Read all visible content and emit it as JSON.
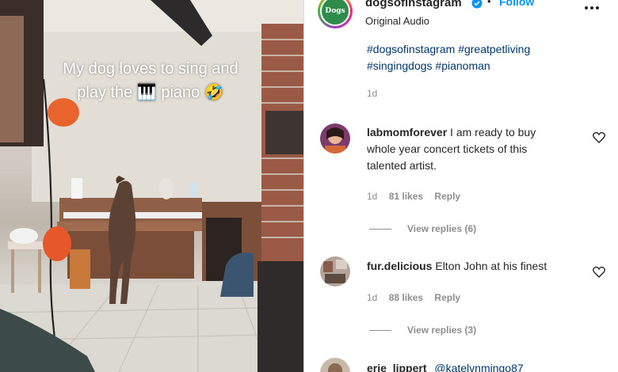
{
  "video": {
    "caption_line1": "My dog loves to sing and",
    "caption_line2_pre": "play the",
    "caption_line2_post": "piano",
    "piano_emoji": "🎹",
    "laugh_emoji": "🤣"
  },
  "post": {
    "username": "dogsofinstagram",
    "dot": "•",
    "follow_label": "Follow",
    "audio": "Original Audio",
    "avatar_text": "Dogs",
    "hashtags": [
      "#dogsofinstagram",
      "#greatpetliving",
      "#singingdogs",
      "#pianoman"
    ],
    "time": "1d"
  },
  "comments": [
    {
      "username": "labmomforever",
      "text": "I am ready to buy whole year concert tickets of this talented artist.",
      "time": "1d",
      "likes": "81 likes",
      "reply_label": "Reply",
      "view_replies": "View replies (6)"
    },
    {
      "username": "fur.delicious",
      "text": "Elton John at his finest",
      "time": "1d",
      "likes": "88 likes",
      "reply_label": "Reply",
      "view_replies": "View replies (3)"
    },
    {
      "username": "erie_lippert",
      "mention": "@katelynmingo87"
    }
  ],
  "colors": {
    "link": "#00376b",
    "follow": "#0095f6",
    "muted": "#8e8e8e",
    "text": "#262626"
  }
}
